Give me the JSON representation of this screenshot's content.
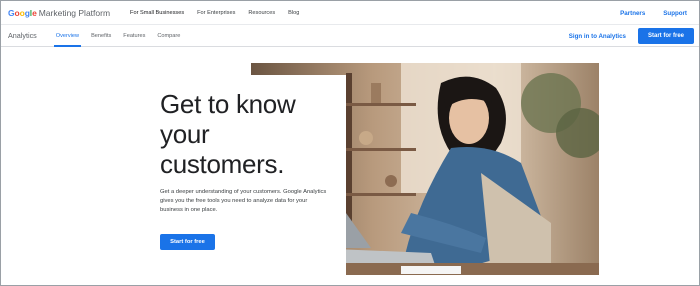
{
  "header": {
    "logo_google": "Google",
    "logo_platform": "Marketing Platform",
    "nav": [
      "For Small Businesses",
      "For Enterprises",
      "Resources",
      "Blog"
    ],
    "active_nav": "For Small Businesses",
    "partners": "Partners",
    "support": "Support"
  },
  "subheader": {
    "product": "Analytics",
    "tabs": [
      "Overview",
      "Benefits",
      "Features",
      "Compare"
    ],
    "active_tab": "Overview",
    "sign_in": "Sign in to Analytics",
    "start_free": "Start for free"
  },
  "hero": {
    "headline_lines": [
      "Get to know",
      "your",
      "customers."
    ],
    "description": "Get a deeper understanding of your customers. Google Analytics gives you the free tools you need to analyze data for your business in one place.",
    "cta": "Start for free"
  },
  "colors": {
    "brand_blue": "#1a73e8",
    "text_dark": "#202124",
    "text_muted": "#5f6368"
  }
}
